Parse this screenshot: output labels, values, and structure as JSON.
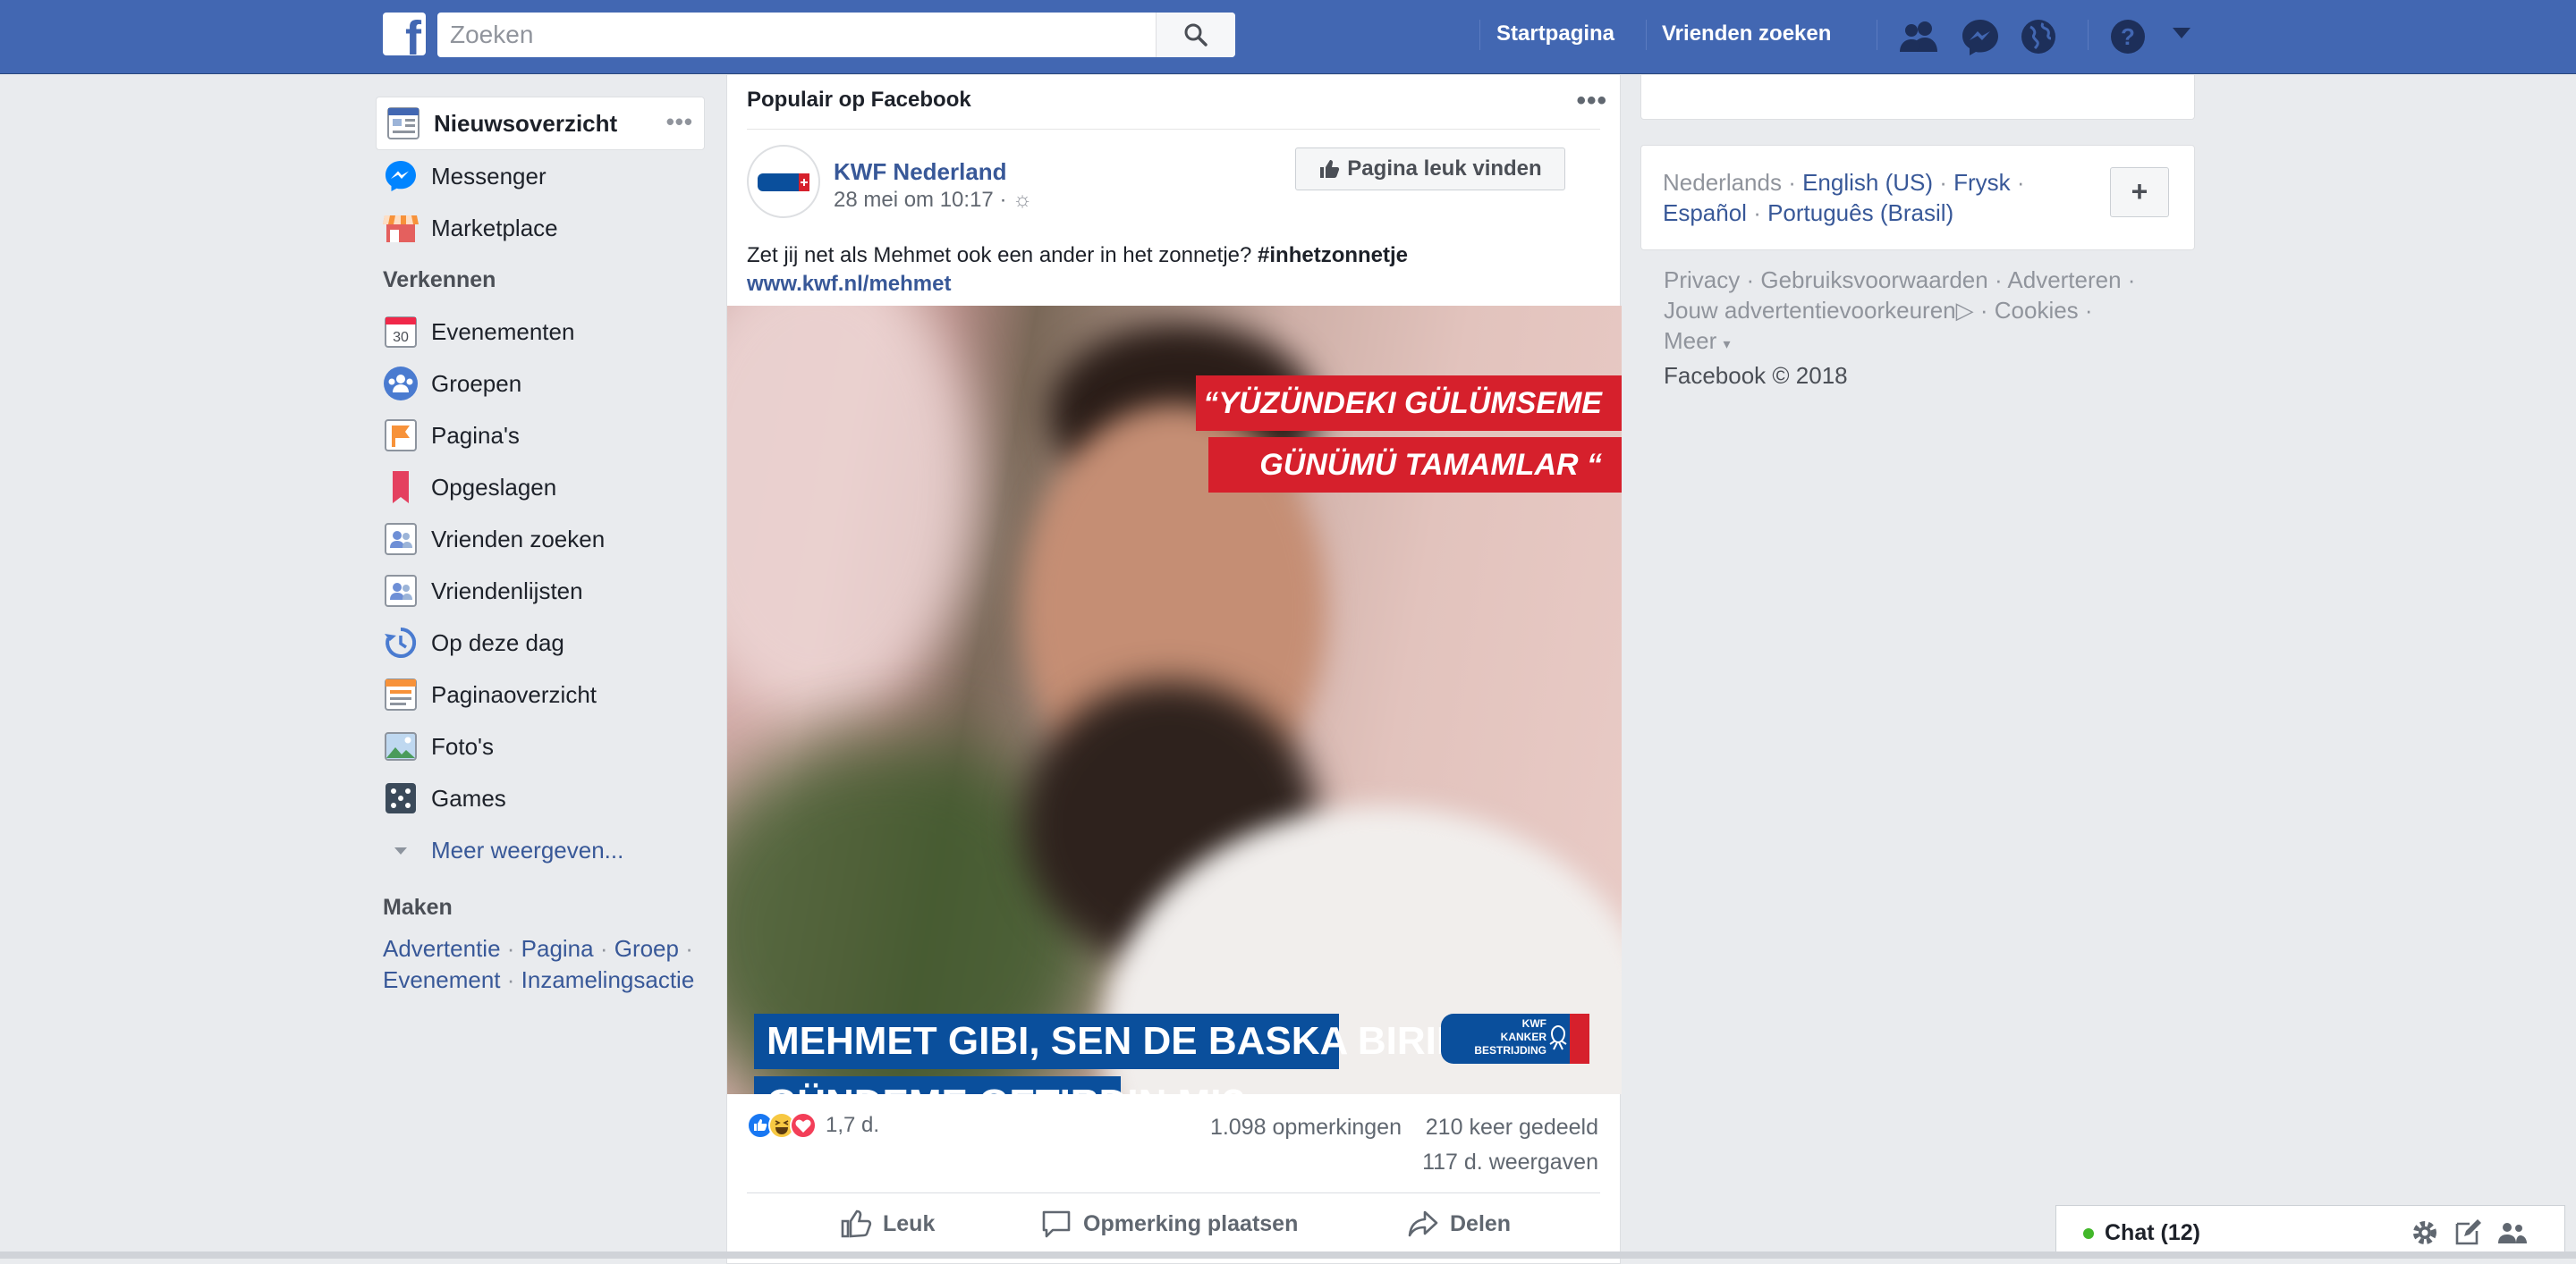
{
  "topbar": {
    "logo": "f",
    "search_placeholder": "Zoeken",
    "nav": [
      "Startpagina",
      "Vrienden zoeken"
    ],
    "icons": [
      "friend-requests-icon",
      "messenger-icon",
      "notifications-globe-icon",
      "help-icon",
      "dropdown-caret-icon"
    ],
    "brand_color": "#4267b2"
  },
  "leftnav": {
    "items": [
      {
        "label": "Nieuwsoverzicht",
        "icon": "news-feed-icon"
      },
      {
        "label": "Messenger",
        "icon": "messenger-icon"
      },
      {
        "label": "Marketplace",
        "icon": "marketplace-icon"
      }
    ],
    "explore_heading": "Verkennen",
    "explore": [
      {
        "label": "Evenementen",
        "icon": "events-calendar-icon",
        "badge": "30"
      },
      {
        "label": "Groepen",
        "icon": "groups-icon"
      },
      {
        "label": "Pagina's",
        "icon": "pages-flag-icon"
      },
      {
        "label": "Opgeslagen",
        "icon": "saved-bookmark-icon"
      },
      {
        "label": "Vrienden zoeken",
        "icon": "find-friends-icon"
      },
      {
        "label": "Vriendenlijsten",
        "icon": "friend-lists-icon"
      },
      {
        "label": "Op deze dag",
        "icon": "on-this-day-icon"
      },
      {
        "label": "Paginaoverzicht",
        "icon": "pages-feed-icon"
      },
      {
        "label": "Foto's",
        "icon": "photos-icon"
      },
      {
        "label": "Games",
        "icon": "games-icon"
      }
    ],
    "more": "Meer weergeven...",
    "make_heading": "Maken",
    "make_links": [
      "Advertentie",
      "Pagina",
      "Groep",
      "Evenement",
      "Inzamelingsactie"
    ]
  },
  "post": {
    "header": "Populair op Facebook",
    "page_name": "KWF Nederland",
    "timestamp": "28 mei om 10:17",
    "like_page_button": "Pagina leuk vinden",
    "text": "Zet jij net als Mehmet ook een ander in het zonnetje? ",
    "hashtag": "#inhetzonnetje",
    "link": "www.kwf.nl/mehmet",
    "image": {
      "quote_line1": "“YÜZÜNDEKI GÜLÜMSEME",
      "quote_line2": "GÜNÜMÜ TAMAMLAR “",
      "caption_line1": "MEHMET GIBI, SEN DE BASKA BIRILERINI",
      "caption_line2": "GÜNDEME GETIRDIN MI?",
      "logo_text": [
        "KWF",
        "KANKER",
        "BESTRIJDING"
      ]
    },
    "reactions_count": "1,7 d.",
    "comments": "1.098 opmerkingen",
    "shares": "210 keer gedeeld",
    "views": "117 d. weergaven",
    "actions": [
      "Leuk",
      "Opmerking plaatsen",
      "Delen"
    ]
  },
  "right": {
    "languages": {
      "current": "Nederlands",
      "others": [
        "English (US)",
        "Frysk",
        "Español",
        "Português (Brasil)"
      ],
      "add": "+"
    },
    "footer": [
      "Privacy",
      "Gebruiksvoorwaarden",
      "Adverteren",
      "Jouw advertentievoorkeuren",
      "Cookies",
      "Meer"
    ],
    "copyright": "Facebook © 2018"
  },
  "chat": {
    "label": "Chat (12)",
    "status_color": "#42b72a"
  }
}
